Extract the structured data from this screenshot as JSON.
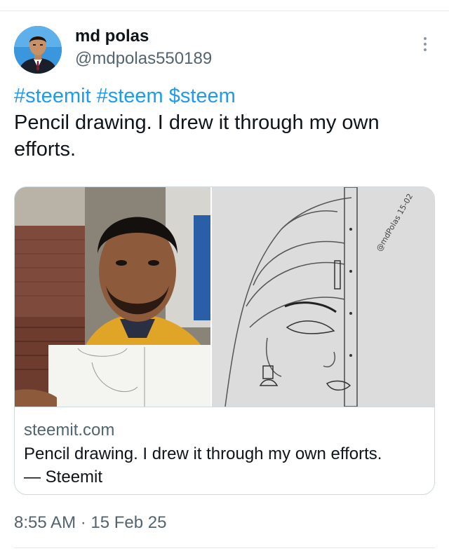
{
  "author": {
    "display_name": "md polas",
    "handle": "@mdpolas550189"
  },
  "tweet": {
    "tags": [
      "#steemit",
      "#steem",
      "$steem"
    ],
    "text": "Pencil drawing. I drew it through my own efforts."
  },
  "card": {
    "domain": "steemit.com",
    "title": "Pencil drawing. I drew it through my own efforts.",
    "source": "— Steemit",
    "image_signature": "@mdPolas 15-02"
  },
  "meta": {
    "time": "8:55 AM",
    "separator": "·",
    "date": "15 Feb 25"
  },
  "colors": {
    "link": "#1d9bf0",
    "text": "#0f1419",
    "muted": "#536471",
    "border": "#cfd9de"
  },
  "icons": {
    "more": "more-vertical-icon"
  }
}
